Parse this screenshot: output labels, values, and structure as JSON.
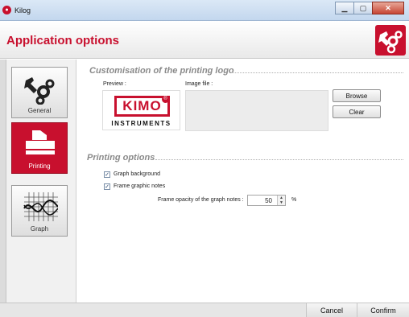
{
  "window": {
    "title": "Kilog"
  },
  "header": {
    "title": "Application options"
  },
  "sidebar": {
    "items": [
      {
        "label": "General"
      },
      {
        "label": "Printing"
      },
      {
        "label": "Graph"
      }
    ]
  },
  "logo_section": {
    "title": "Customisation of the printing logo",
    "preview_label": "Preview :",
    "image_file_label": "Image file :",
    "logo_text": "KIMO",
    "logo_subtext": "INSTRUMENTS",
    "logo_registered": "®",
    "browse_label": "Browse",
    "clear_label": "Clear"
  },
  "printing_section": {
    "title": "Printing options",
    "graph_background_label": "Graph background",
    "graph_background_checked": true,
    "frame_notes_label": "Frame graphic notes",
    "frame_notes_checked": true,
    "opacity_label": "Frame opacity of the graph notes :",
    "opacity_value": "50",
    "opacity_unit": "%"
  },
  "footer": {
    "cancel_label": "Cancel",
    "confirm_label": "Confirm"
  },
  "colors": {
    "accent": "#c8102e"
  }
}
